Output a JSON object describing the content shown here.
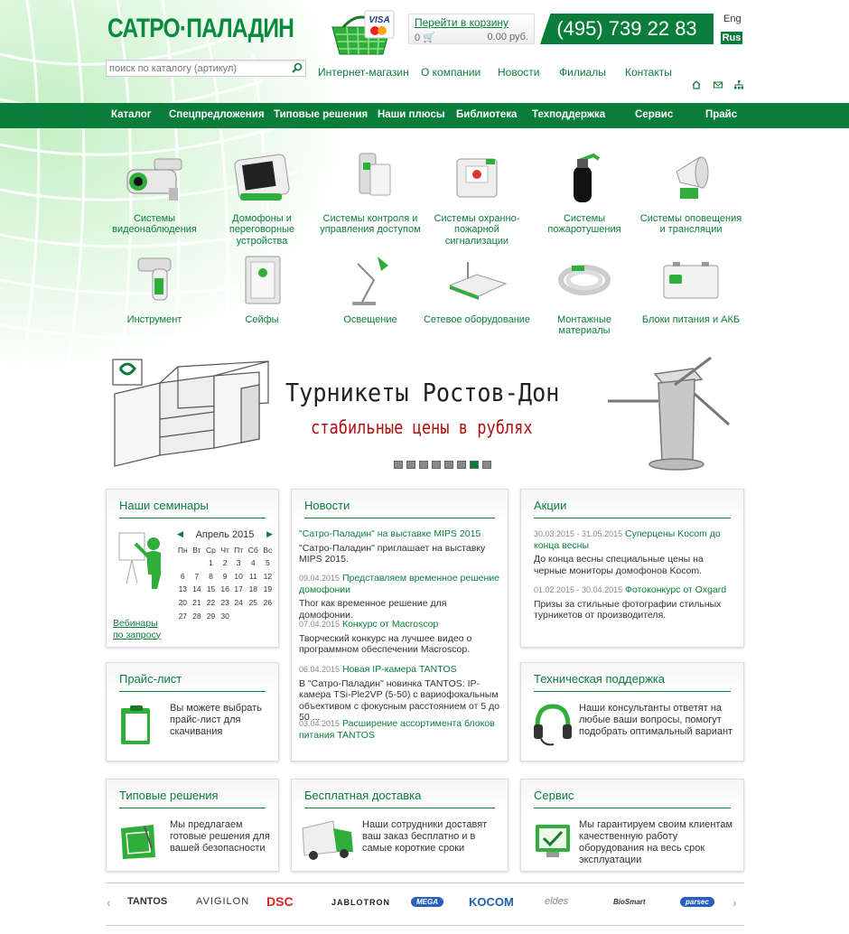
{
  "header": {
    "logo_text": "САТРО·ПАЛАДИН",
    "basket_brands": [
      "VISA",
      "MasterCard"
    ],
    "cart_link": "Перейти в корзину",
    "cart_count": "0",
    "cart_sum": "0.00 руб.",
    "phone": "(495) 739 22 83",
    "lang_eng": "Eng",
    "lang_rus": "Rus",
    "search_placeholder": "поиск по каталогу (артикул)",
    "topnav": [
      "Интернет-магазин",
      "О компании",
      "Новости",
      "Филиалы",
      "Контакты"
    ],
    "icons": [
      "home-icon",
      "mail-icon",
      "sitemap-icon"
    ]
  },
  "mainnav": [
    "Каталог",
    "Спецпредложения",
    "Типовые решения",
    "Наши плюсы",
    "Библиотека",
    "Техподдержка",
    "Сервис",
    "Прайс"
  ],
  "categories": [
    {
      "label": "Системы видеонаблюдения",
      "icon": "camera-icon"
    },
    {
      "label": "Домофоны и переговорные устройства",
      "icon": "intercom-icon"
    },
    {
      "label": "Системы контроля и управления доступом",
      "icon": "access-card-icon"
    },
    {
      "label": "Системы охранно-пожарной сигнализации",
      "icon": "alarm-icon"
    },
    {
      "label": "Системы пожаротушения",
      "icon": "extinguisher-icon"
    },
    {
      "label": "Системы оповещения и трансляции",
      "icon": "loudspeaker-icon"
    },
    {
      "label": "Инструмент",
      "icon": "drill-icon"
    },
    {
      "label": "Сейфы",
      "icon": "safe-icon"
    },
    {
      "label": "Освещение",
      "icon": "lamp-icon"
    },
    {
      "label": "Сетевое оборудование",
      "icon": "router-icon"
    },
    {
      "label": "Монтажные материалы",
      "icon": "cable-icon"
    },
    {
      "label": "Блоки питания и АКБ",
      "icon": "battery-icon"
    }
  ],
  "banner": {
    "title": "Турникеты Ростов-Дон",
    "subtitle": "стабильные цены в рублях",
    "slide_count": 8,
    "active_slide": 6
  },
  "seminars": {
    "title": "Наши семинары",
    "month": "Апрель 2015",
    "weekdays": [
      "Пн",
      "Вт",
      "Ср",
      "Чт",
      "Пт",
      "Сб",
      "Вс"
    ],
    "weeks": [
      [
        "",
        "",
        "1",
        "2",
        "3",
        "4",
        "5"
      ],
      [
        "6",
        "7",
        "8",
        "9",
        "10",
        "11",
        "12"
      ],
      [
        "13",
        "14",
        "15",
        "16",
        "17",
        "18",
        "19"
      ],
      [
        "20",
        "21",
        "22",
        "23",
        "24",
        "25",
        "26"
      ],
      [
        "27",
        "28",
        "29",
        "30",
        "",
        "",
        ""
      ]
    ],
    "webinar_link": "Вебинары по запросу"
  },
  "news": {
    "title": "Новости",
    "items": [
      {
        "date": "",
        "title": "\"Сатро-Паладин\" на выставке MIPS 2015",
        "text": "\"Сатро-Паладин\" приглашает на выставку MIPS 2015."
      },
      {
        "date": "09.04.2015",
        "title": "Представляем временное решение домофонии",
        "text": "Thor как временное решение для домофонии."
      },
      {
        "date": "07.04.2015",
        "title": "Конкурс от Macroscop",
        "text": "Творческий конкурс на лучшее видео о программном обеспечении Macroscop."
      },
      {
        "date": "06.04.2015",
        "title": "Новая IP-камера TANTOS",
        "text": "В \"Сатро-Паладин\" новинка TANTOS: IP-камера TSi-Ple2VP (5-50) с вариофокальным объективом с фокусным расстоянием от 5 до 50 ..."
      },
      {
        "date": "03.04.2015",
        "title": "Расширение ассортимента блоков питания TANTOS",
        "text": ""
      }
    ]
  },
  "actions": {
    "title": "Акции",
    "items": [
      {
        "date": "30.03.2015 - 31.05.2015",
        "title": "Суперцены Kocom до конца весны",
        "text": "До конца весны специальные цены на черные мониторы домофонов Kocom."
      },
      {
        "date": "01.02.2015 - 30.04.2015",
        "title": "Фотоконкурс от Oxgard",
        "text": "Призы за стильные фотографии стильных турникетов от производителя."
      }
    ]
  },
  "price": {
    "title": "Прайс-лист",
    "text": "Вы можете выбрать прайс-лист для скачивания"
  },
  "support": {
    "title": "Техническая поддержка",
    "text": "Наши консультанты ответят на любые ваши вопросы, помогут подобрать оптимальный вариант"
  },
  "solutions": {
    "title": "Типовые решения",
    "text": "Мы предлагаем готовые решения для вашей безопасности"
  },
  "delivery": {
    "title": "Бесплатная доставка",
    "text": "Наши сотрудники доставят ваш заказ бесплатно и в самые короткие сроки"
  },
  "service": {
    "title": "Сервис",
    "text": "Мы гарантируем своим клиентам качественную работу оборудования на весь срок эксплуатации"
  },
  "brands": [
    "TANTOS",
    "AVIGILON",
    "DSC",
    "JABLOTRON",
    "MEGA",
    "KOCOM",
    "eldes",
    "BioSmart",
    "parsec"
  ],
  "colors": {
    "brand_green": "#0a7d3b",
    "accent_red": "#b01010"
  }
}
